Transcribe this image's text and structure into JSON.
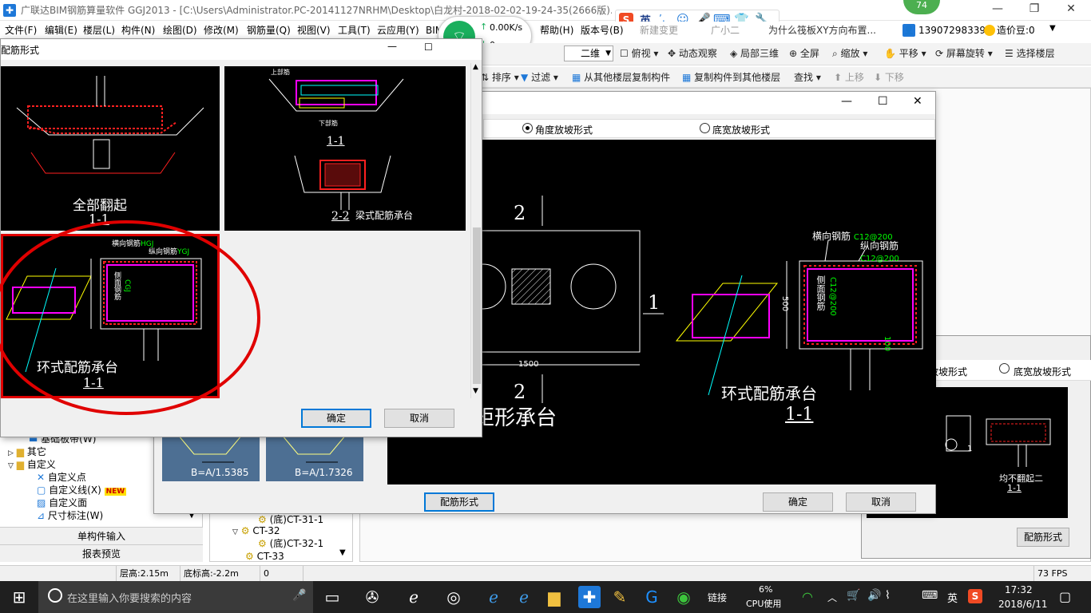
{
  "app": {
    "title": "广联达BIM钢筋算量软件 GGJ2013 - [C:\\Users\\Administrator.PC-20141127NRHM\\Desktop\\白龙村-2018-02-02-19-24-35(2666版).GGJ12]",
    "user_phone": "13907298339",
    "price_beans": "造价豆:0",
    "news_hint": "为什么筏板XY方向布置...",
    "badge_count": "74",
    "help_label": "帮助(H)",
    "version_label": "版本号(B)",
    "new_build": "新建变更",
    "guangxiaoer": "广小二"
  },
  "menu": [
    "文件(F)",
    "编辑(E)",
    "楼层(L)",
    "构件(N)",
    "绘图(D)",
    "修改(M)",
    "钢筋量(Q)",
    "视图(V)",
    "工具(T)",
    "云应用(Y)",
    "BIM"
  ],
  "toolbar1": {
    "view_select": "二维",
    "top_view": "俯视",
    "dynamic": "动态观察",
    "local3d": "局部三维",
    "fullscreen": "全屏",
    "zoom": "缩放",
    "pan": "平移",
    "rotate": "屏幕旋转",
    "select_floor": "选择楼层"
  },
  "toolbar2": {
    "sort": "排序",
    "filter": "过滤",
    "copy_from": "从其他楼层复制构件",
    "copy_to": "复制构件到其他楼层",
    "find": "查找",
    "move_up": "上移",
    "move_down": "下移"
  },
  "net_widget": {
    "speed_up": "0.00K/s",
    "speed_down": "0"
  },
  "ime": {
    "lang": "英"
  },
  "dialog_rebar": {
    "title": "配筋形式",
    "thumb1": {
      "caption": "全部翻起",
      "section": "1-1"
    },
    "thumb2": {
      "section_a": "1-1",
      "section_b": "2-2",
      "caption": "梁式配筋承台",
      "top": "上部筋",
      "bottom": "下部筋"
    },
    "thumb3": {
      "caption": "环式配筋承台",
      "section": "1-1",
      "label_h": "横向钢筋",
      "label_v": "纵向钢筋",
      "label_side": "侧面钢筋",
      "code_h": "HGJ",
      "code_v": "YGJ",
      "code_side": "CGJ"
    },
    "ok": "确定",
    "cancel": "取消"
  },
  "dialog_shape": {
    "radio_angle": "角度放坡形式",
    "radio_width": "底宽放坡形式",
    "radio_selected": "angle",
    "preview": {
      "left_num_2_top": "2",
      "left_num_1": "1",
      "left_num_2_bottom": "2",
      "dim_width": "1500",
      "left_caption": "矩形承台",
      "right_label_h": "横向钢筋",
      "right_val_h": "C12@200",
      "right_label_v": "纵向钢筋",
      "right_val_v": "C12@200",
      "right_label_side": "侧面钢筋",
      "right_val_side": "C12@200",
      "dim_500": "500",
      "dim_100": "100",
      "right_caption": "环式配筋承台",
      "right_section": "1-1"
    },
    "btn_rebar_form": "配筋形式",
    "ok": "确定",
    "cancel": "取消"
  },
  "dialog_back": {
    "radio_angle": "放坡形式",
    "radio_width": "底宽放坡形式",
    "caption": "均不翻起二",
    "section": "1-1",
    "dim": "1",
    "btn_rebar_form": "配筋形式"
  },
  "left_tree": [
    {
      "label": "基础板带(W)",
      "indent": 3
    },
    {
      "label": "其它",
      "indent": 1,
      "folder": true
    },
    {
      "label": "自定义",
      "indent": 1,
      "folder": true,
      "open": true
    },
    {
      "label": "自定义点",
      "indent": 3
    },
    {
      "label": "自定义线(X)",
      "indent": 3,
      "new": "NEW"
    },
    {
      "label": "自定义面",
      "indent": 3
    },
    {
      "label": "尺寸标注(W)",
      "indent": 3
    }
  ],
  "left_buttons": [
    "单构件输入",
    "报表预览"
  ],
  "thumbs_bottom": [
    "B=A/1.5385",
    "B=A/1.7326"
  ],
  "comp_tree": [
    {
      "label": "(底)CT-31-1",
      "indent": 2
    },
    {
      "label": "CT-32",
      "indent": 1
    },
    {
      "label": "(底)CT-32-1",
      "indent": 2
    },
    {
      "label": "CT-33",
      "indent": 1
    }
  ],
  "statusbar": {
    "floor_height": "层高:2.15m",
    "base_height": "底标高:-2.2m",
    "zero": "0",
    "fps": "73 FPS"
  },
  "taskbar": {
    "search_placeholder": "在这里输入你要搜索的内容",
    "link": "链接",
    "cpu_pct": "6%",
    "cpu_label": "CPU使用",
    "lang": "英",
    "time": "17:32",
    "date": "2018/6/11"
  },
  "colors": {
    "cad_bg": "#000000",
    "cad_white": "#ffffff",
    "cad_red": "#ff2020",
    "cad_magenta": "#ff00ff",
    "cad_yellow": "#ffff00",
    "cad_cyan": "#00ffff",
    "cad_green": "#00ff00",
    "annotation_red": "#e00000",
    "taskbar": "#1f1f1f",
    "accent": "#0078d7"
  }
}
